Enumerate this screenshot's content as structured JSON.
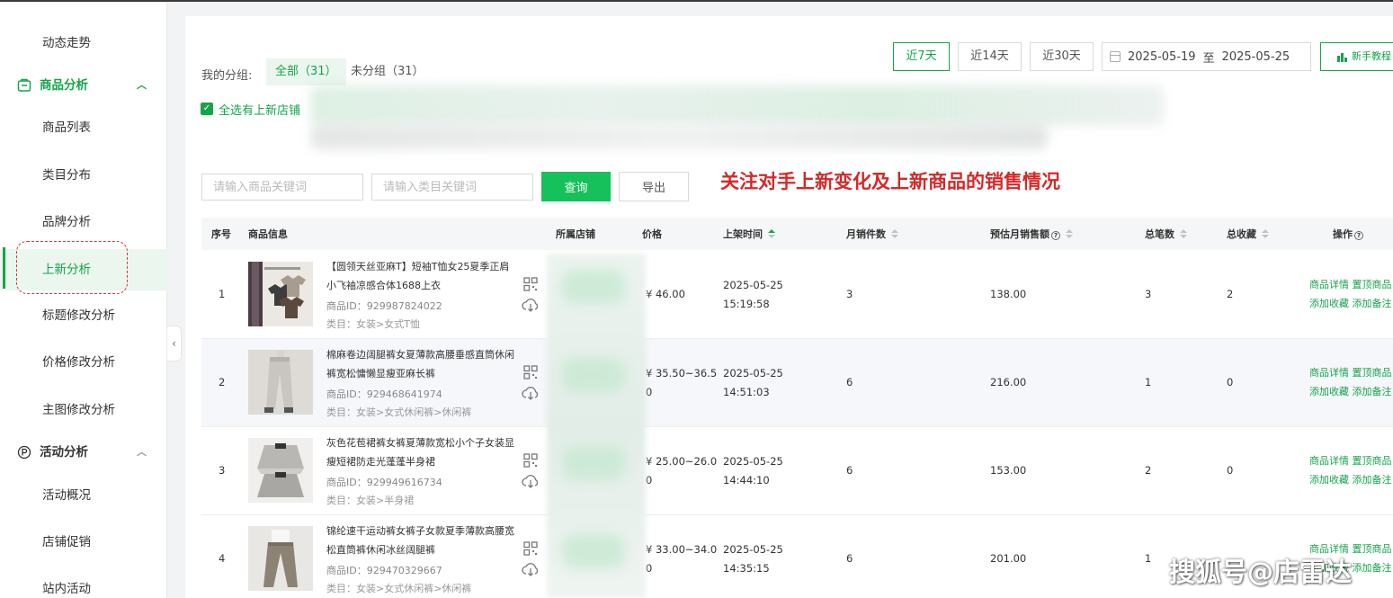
{
  "sidebar": {
    "item_trend": "动态走势",
    "group_product": "商品分析",
    "item_list": "商品列表",
    "item_category": "类目分布",
    "item_brand": "品牌分析",
    "item_new": "上新分析",
    "item_title": "标题修改分析",
    "item_price": "价格修改分析",
    "item_mainimg": "主图修改分析",
    "group_activity": "活动分析",
    "item_overview": "活动概况",
    "item_promo": "店铺促销",
    "item_site": "站内活动"
  },
  "groups": {
    "label": "我的分组:",
    "all": "全部（31）",
    "ungrouped": "未分组（31）"
  },
  "select_all": "全选有上新店铺",
  "date": {
    "b7": "近7天",
    "b14": "近14天",
    "b30": "近30天",
    "start": "2025-05-19",
    "sep": "至",
    "end": "2025-05-25",
    "guide": "新手教程"
  },
  "search": {
    "product_placeholder": "请输入商品关键词",
    "category_placeholder": "请输入类目关键词",
    "query": "查询",
    "export": "导出"
  },
  "annotation": "关注对手上新变化及上新商品的销售情况",
  "columns": {
    "idx": "序号",
    "info": "商品信息",
    "store": "所属店铺",
    "price": "价格",
    "time": "上架时间",
    "monthly_qty": "月销件数",
    "monthly_sales": "预估月销售额",
    "orders": "总笔数",
    "favs": "总收藏",
    "ops": "操作"
  },
  "ops": {
    "detail": "商品详情",
    "pin": "置顶商品",
    "fav": "添加收藏",
    "note": "添加备注"
  },
  "rows": [
    {
      "idx": "1",
      "title": "【圆领天丝亚麻T】短袖T恤女25夏季正肩小飞袖凉感合体1688上衣",
      "id": "商品ID：929987824022",
      "cat": "类目：女装>女式T恤",
      "price": "¥ 46.00",
      "date": "2025-05-25",
      "time": "15:19:58",
      "qty": "3",
      "sales": "138.00",
      "orders": "3",
      "favs": "2"
    },
    {
      "idx": "2",
      "title": "棉麻卷边阔腿裤女夏薄款高腰垂感直筒休闲裤宽松慵懒显瘦亚麻长裤",
      "id": "商品ID：929468641974",
      "cat": "类目：女装>女式休闲裤>休闲裤",
      "price": "¥ 35.50~36.5",
      "price2": "0",
      "date": "2025-05-25",
      "time": "14:51:03",
      "qty": "6",
      "sales": "216.00",
      "orders": "1",
      "favs": "0"
    },
    {
      "idx": "3",
      "title": "灰色花苞裙裤女裤夏薄款宽松小个子女装显瘦短裙防走光蓬蓬半身裙",
      "id": "商品ID：929949616734",
      "cat": "类目：女装>半身裙",
      "price": "¥ 25.00~26.0",
      "price2": "0",
      "date": "2025-05-25",
      "time": "14:44:10",
      "qty": "6",
      "sales": "153.00",
      "orders": "2",
      "favs": "0"
    },
    {
      "idx": "4",
      "title": "锦纶速干运动裤女裤子女款夏季薄款高腰宽松直筒裤休闲冰丝阔腿裤",
      "id": "商品ID：929470329667",
      "cat": "类目：女装>女式休闲裤>休闲裤",
      "price": "¥ 33.00~34.0",
      "price2": "0",
      "date": "2025-05-25",
      "time": "14:35:15",
      "qty": "6",
      "sales": "201.00",
      "orders": "1",
      "favs": ""
    }
  ],
  "watermark": "搜狐号@店雷达"
}
